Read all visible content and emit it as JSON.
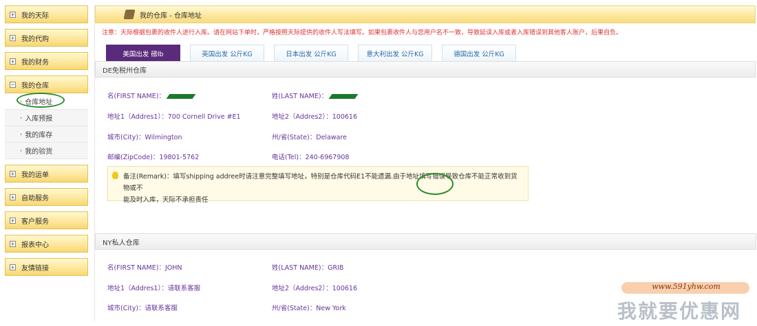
{
  "sidebar": {
    "items": [
      {
        "label": "我的天际"
      },
      {
        "label": "我的代购"
      },
      {
        "label": "我的财务"
      },
      {
        "label": "我的仓库",
        "sub": [
          "仓库地址",
          "入库预报",
          "我的库存",
          "我的验货"
        ]
      },
      {
        "label": "我的运单"
      },
      {
        "label": "自助服务"
      },
      {
        "label": "客户服务"
      },
      {
        "label": "报表中心"
      },
      {
        "label": "友情链接"
      }
    ]
  },
  "header": {
    "title": "我的仓库 - 仓库地址"
  },
  "notice": "注意：天际根据包裹的收件人进行入库。请在网站下单时，严格按照天际提供的收件人写法填写。如果包裹收件人与您用户名不一致，导致延误入库或者入库错误到其他客人账户，后果自负。",
  "tabs": [
    "美国出发 磅lb",
    "英国出发 公斤KG",
    "日本出发 公斤KG",
    "意大利出发 公斤KG",
    "德国出发 公斤KG"
  ],
  "warehouse1": {
    "name": "DE免税州仓库",
    "first_name_label": "名(FIRST NAME)：",
    "last_name_label": "姓(LAST NAME)：",
    "addr1_label": "地址1（Addres1）：",
    "addr1": "700 Cornell Drive #E1",
    "addr2_label": "地址2（Addres2）：",
    "addr2": "100616",
    "city_label": "城市(City)：",
    "city": "Wilmington",
    "state_label": "州/省(State)：",
    "state": "Delaware",
    "zip_label": "邮编(ZipCode)：",
    "zip": "19801-5762",
    "tel_label": "电话(Tel)：",
    "tel": "240-6967908",
    "remark_line1": "备注(Remark)：填写shipping addree时请注意完整填写地址，特别是仓库代码E1不能遗漏.由于地址填写错误导致仓库不能正常收到货物或不",
    "remark_line2": "能及时入库，天际不承担责任"
  },
  "warehouse2": {
    "name": "NY私人仓库",
    "first_name_label": "名(FIRST NAME)：",
    "first_name": "JOHN",
    "last_name_label": "姓(LAST NAME)：",
    "last_name": "GRIB",
    "addr1_label": "地址1（Addres1）：",
    "addr1": "请联系客服",
    "addr2_label": "地址2（Addres2）：",
    "addr2": "100616",
    "city_label": "城市(City)：",
    "city": "请联系客服",
    "state_label": "州/省(State)：",
    "state": "New York"
  },
  "watermark": {
    "url": "www.591yhw.com",
    "text": "我就要优惠网"
  },
  "colors": {
    "accent_purple": "#5a2b7b",
    "label_purple": "#663399",
    "notice_red": "#e03030",
    "sidebar_gold": "#fde69a"
  }
}
